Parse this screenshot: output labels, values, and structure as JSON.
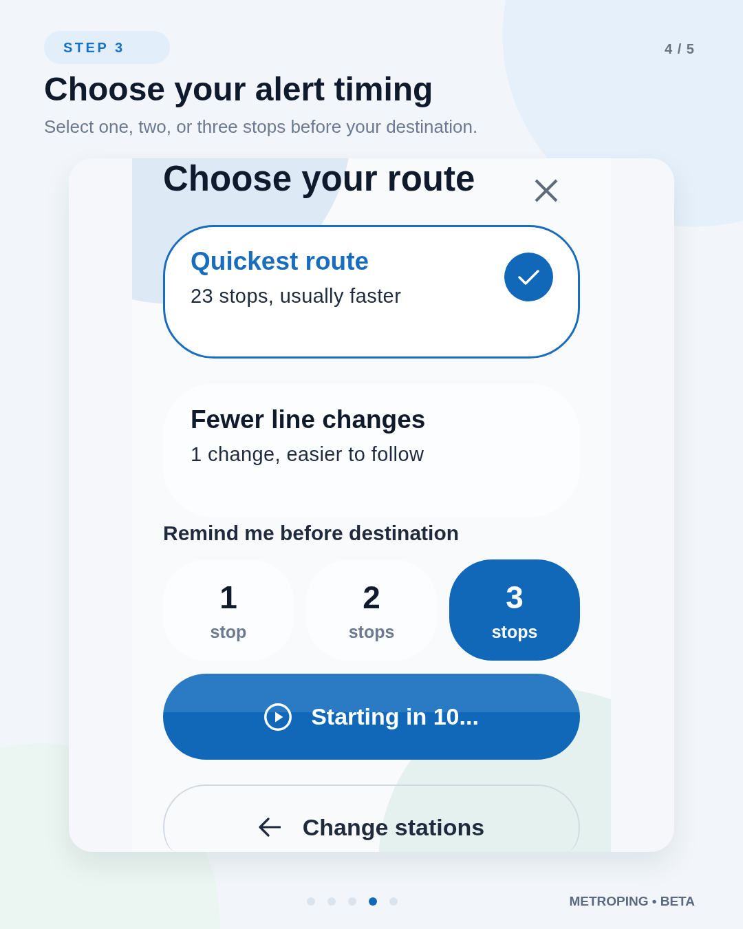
{
  "header": {
    "step_badge": "STEP 3",
    "page_counter": "4 / 5",
    "title": "Choose your alert timing",
    "subtitle": "Select one, two, or three stops before your destination."
  },
  "dialog": {
    "title": "Choose your route",
    "route_options": [
      {
        "title": "Quickest route",
        "description": "23 stops, usually faster",
        "selected": true
      },
      {
        "title": "Fewer line changes",
        "description": "1 change, easier to follow",
        "selected": false
      }
    ],
    "reminder_label": "Remind me before destination",
    "stop_options": [
      {
        "number": "1",
        "unit": "stop",
        "selected": false
      },
      {
        "number": "2",
        "unit": "stops",
        "selected": false
      },
      {
        "number": "3",
        "unit": "stops",
        "selected": true
      }
    ],
    "start_button": "Starting in 10...",
    "back_button": "Change stations"
  },
  "pagination": [
    {
      "selected": false
    },
    {
      "selected": false
    },
    {
      "selected": false
    },
    {
      "selected": true
    },
    {
      "selected": false
    }
  ],
  "footer_brand": "METROPING • BETA"
}
